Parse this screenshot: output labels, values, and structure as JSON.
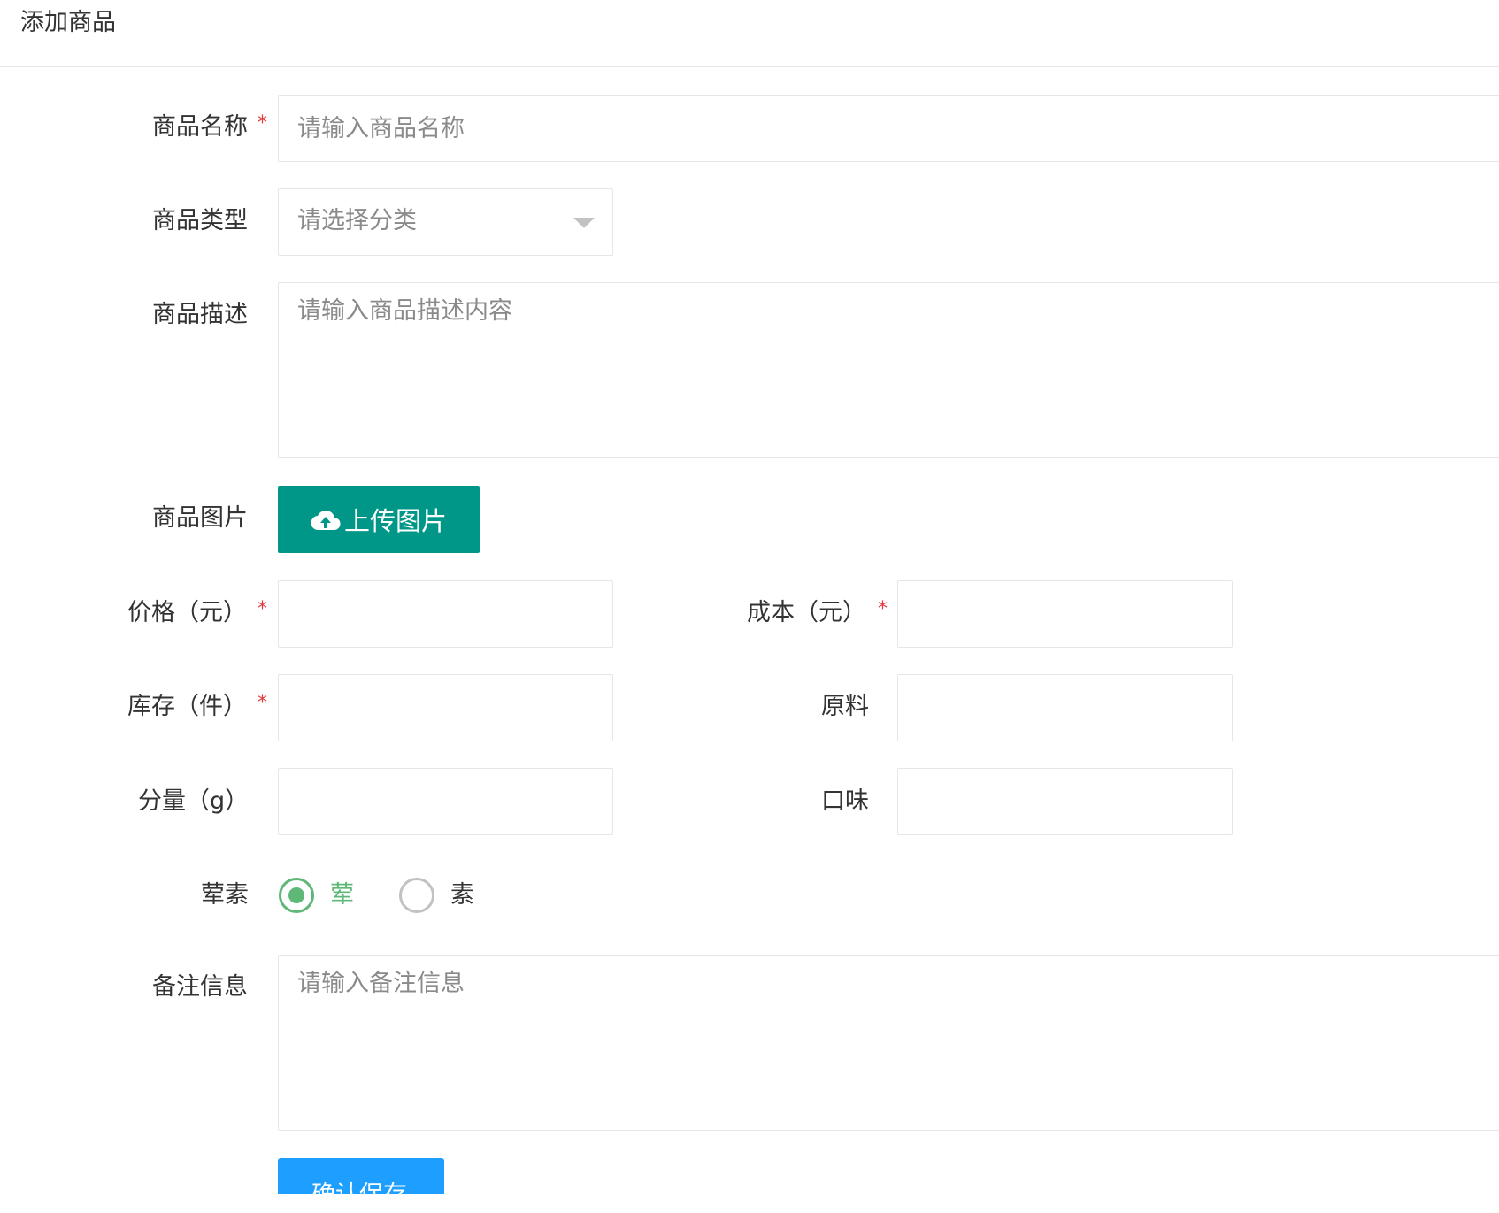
{
  "page": {
    "title": "添加商品"
  },
  "form": {
    "required_mark": "*",
    "name": {
      "label": "商品名称",
      "placeholder": "请输入商品名称",
      "value": ""
    },
    "category": {
      "label": "商品类型",
      "selected": "请选择分类"
    },
    "description": {
      "label": "商品描述",
      "placeholder": "请输入商品描述内容",
      "value": ""
    },
    "image": {
      "label": "商品图片",
      "button_label": "上传图片",
      "icon": "cloud-upload-icon"
    },
    "price": {
      "label": "价格（元）",
      "value": ""
    },
    "cost": {
      "label": "成本（元）",
      "value": ""
    },
    "stock": {
      "label": "库存（件）",
      "value": ""
    },
    "ingredients": {
      "label": "原料",
      "value": ""
    },
    "portion": {
      "label": "分量（g）",
      "value": ""
    },
    "flavor": {
      "label": "口味",
      "value": ""
    },
    "diet": {
      "label": "荤素",
      "options": [
        {
          "label": "荤",
          "checked": true
        },
        {
          "label": "素",
          "checked": false
        }
      ]
    },
    "remark": {
      "label": "备注信息",
      "placeholder": "请输入备注信息",
      "value": ""
    },
    "submit_label": "确认保存"
  },
  "colors": {
    "primary_green": "#009688",
    "radio_green": "#5fb878",
    "submit_blue": "#1e9fff",
    "required_red": "#e4393c",
    "border": "#e6e6e6"
  }
}
